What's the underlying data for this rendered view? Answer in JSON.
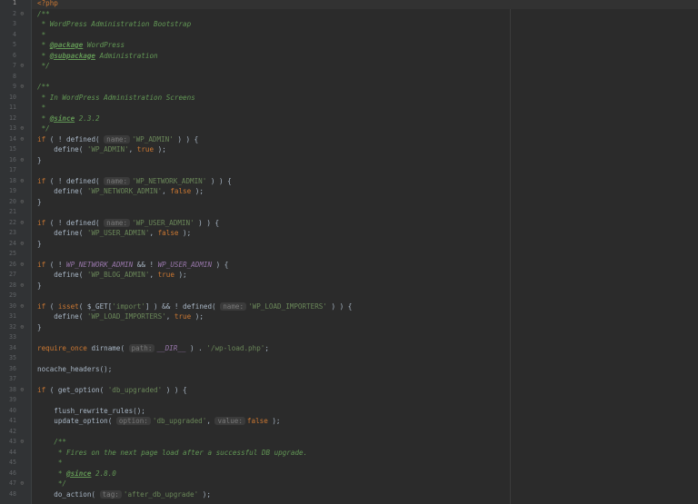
{
  "editor": {
    "current_line": 1,
    "lines": [
      {
        "n": "1",
        "fold": "",
        "segs": [
          {
            "c": "tag",
            "t": "<?php"
          }
        ]
      },
      {
        "n": "2",
        "fold": "⊖",
        "segs": [
          {
            "c": "cm",
            "t": "/**"
          }
        ]
      },
      {
        "n": "3",
        "fold": "",
        "segs": [
          {
            "c": "cm",
            "t": " * WordPress Administration Bootstrap"
          }
        ]
      },
      {
        "n": "4",
        "fold": "",
        "segs": [
          {
            "c": "cm",
            "t": " *"
          }
        ]
      },
      {
        "n": "5",
        "fold": "",
        "segs": [
          {
            "c": "cm",
            "t": " * "
          },
          {
            "c": "cm-tag",
            "t": "@package"
          },
          {
            "c": "cm",
            "t": " WordPress"
          }
        ]
      },
      {
        "n": "6",
        "fold": "",
        "segs": [
          {
            "c": "cm",
            "t": " * "
          },
          {
            "c": "cm-tag",
            "t": "@subpackage"
          },
          {
            "c": "cm",
            "t": " Administration"
          }
        ]
      },
      {
        "n": "7",
        "fold": "⊖",
        "segs": [
          {
            "c": "cm",
            "t": " */"
          }
        ]
      },
      {
        "n": "8",
        "fold": "",
        "segs": []
      },
      {
        "n": "9",
        "fold": "⊖",
        "segs": [
          {
            "c": "cm",
            "t": "/**"
          }
        ]
      },
      {
        "n": "10",
        "fold": "",
        "segs": [
          {
            "c": "cm",
            "t": " * In WordPress Administration Screens"
          }
        ]
      },
      {
        "n": "11",
        "fold": "",
        "segs": [
          {
            "c": "cm",
            "t": " *"
          }
        ]
      },
      {
        "n": "12",
        "fold": "",
        "segs": [
          {
            "c": "cm",
            "t": " * "
          },
          {
            "c": "cm-tag",
            "t": "@since"
          },
          {
            "c": "cm",
            "t": " 2.3.2"
          }
        ]
      },
      {
        "n": "13",
        "fold": "⊖",
        "segs": [
          {
            "c": "cm",
            "t": " */"
          }
        ]
      },
      {
        "n": "14",
        "fold": "⊖",
        "segs": [
          {
            "c": "kw",
            "t": "if"
          },
          {
            "c": "var",
            "t": " ( ! defined( "
          },
          {
            "c": "hint",
            "t": "name:"
          },
          {
            "c": "str",
            "t": "'WP_ADMIN'"
          },
          {
            "c": "var",
            "t": " ) ) {"
          }
        ]
      },
      {
        "n": "15",
        "fold": "",
        "segs": [
          {
            "c": "var",
            "t": "    define( "
          },
          {
            "c": "str",
            "t": "'WP_ADMIN'"
          },
          {
            "c": "var",
            "t": ", "
          },
          {
            "c": "kw",
            "t": "true"
          },
          {
            "c": "var",
            "t": " );"
          }
        ]
      },
      {
        "n": "16",
        "fold": "⊖",
        "segs": [
          {
            "c": "var",
            "t": "}"
          }
        ]
      },
      {
        "n": "17",
        "fold": "",
        "segs": []
      },
      {
        "n": "18",
        "fold": "⊖",
        "segs": [
          {
            "c": "kw",
            "t": "if"
          },
          {
            "c": "var",
            "t": " ( ! defined( "
          },
          {
            "c": "hint",
            "t": "name:"
          },
          {
            "c": "str",
            "t": "'WP_NETWORK_ADMIN'"
          },
          {
            "c": "var",
            "t": " ) ) {"
          }
        ]
      },
      {
        "n": "19",
        "fold": "",
        "segs": [
          {
            "c": "var",
            "t": "    define( "
          },
          {
            "c": "str",
            "t": "'WP_NETWORK_ADMIN'"
          },
          {
            "c": "var",
            "t": ", "
          },
          {
            "c": "kw",
            "t": "false"
          },
          {
            "c": "var",
            "t": " );"
          }
        ]
      },
      {
        "n": "20",
        "fold": "⊖",
        "segs": [
          {
            "c": "var",
            "t": "}"
          }
        ]
      },
      {
        "n": "21",
        "fold": "",
        "segs": []
      },
      {
        "n": "22",
        "fold": "⊖",
        "segs": [
          {
            "c": "kw",
            "t": "if"
          },
          {
            "c": "var",
            "t": " ( ! defined( "
          },
          {
            "c": "hint",
            "t": "name:"
          },
          {
            "c": "str",
            "t": "'WP_USER_ADMIN'"
          },
          {
            "c": "var",
            "t": " ) ) {"
          }
        ]
      },
      {
        "n": "23",
        "fold": "",
        "segs": [
          {
            "c": "var",
            "t": "    define( "
          },
          {
            "c": "str",
            "t": "'WP_USER_ADMIN'"
          },
          {
            "c": "var",
            "t": ", "
          },
          {
            "c": "kw",
            "t": "false"
          },
          {
            "c": "var",
            "t": " );"
          }
        ]
      },
      {
        "n": "24",
        "fold": "⊖",
        "segs": [
          {
            "c": "var",
            "t": "}"
          }
        ]
      },
      {
        "n": "25",
        "fold": "",
        "segs": []
      },
      {
        "n": "26",
        "fold": "⊖",
        "segs": [
          {
            "c": "kw",
            "t": "if"
          },
          {
            "c": "var",
            "t": " ( ! "
          },
          {
            "c": "cst",
            "t": "WP_NETWORK_ADMIN"
          },
          {
            "c": "var",
            "t": " && ! "
          },
          {
            "c": "cst",
            "t": "WP_USER_ADMIN"
          },
          {
            "c": "var",
            "t": " ) {"
          }
        ]
      },
      {
        "n": "27",
        "fold": "",
        "segs": [
          {
            "c": "var",
            "t": "    define( "
          },
          {
            "c": "str",
            "t": "'WP_BLOG_ADMIN'"
          },
          {
            "c": "var",
            "t": ", "
          },
          {
            "c": "kw",
            "t": "true"
          },
          {
            "c": "var",
            "t": " );"
          }
        ]
      },
      {
        "n": "28",
        "fold": "⊖",
        "segs": [
          {
            "c": "var",
            "t": "}"
          }
        ]
      },
      {
        "n": "29",
        "fold": "",
        "segs": []
      },
      {
        "n": "30",
        "fold": "⊖",
        "segs": [
          {
            "c": "kw",
            "t": "if"
          },
          {
            "c": "var",
            "t": " ( "
          },
          {
            "c": "kw",
            "t": "isset"
          },
          {
            "c": "var",
            "t": "( $_GET["
          },
          {
            "c": "str",
            "t": "'import'"
          },
          {
            "c": "var",
            "t": "] ) && ! defined( "
          },
          {
            "c": "hint",
            "t": "name:"
          },
          {
            "c": "str",
            "t": "'WP_LOAD_IMPORTERS'"
          },
          {
            "c": "var",
            "t": " ) ) {"
          }
        ]
      },
      {
        "n": "31",
        "fold": "",
        "segs": [
          {
            "c": "var",
            "t": "    define( "
          },
          {
            "c": "str",
            "t": "'WP_LOAD_IMPORTERS'"
          },
          {
            "c": "var",
            "t": ", "
          },
          {
            "c": "kw",
            "t": "true"
          },
          {
            "c": "var",
            "t": " );"
          }
        ]
      },
      {
        "n": "32",
        "fold": "⊖",
        "segs": [
          {
            "c": "var",
            "t": "}"
          }
        ]
      },
      {
        "n": "33",
        "fold": "",
        "segs": []
      },
      {
        "n": "34",
        "fold": "",
        "segs": [
          {
            "c": "kw",
            "t": "require_once"
          },
          {
            "c": "var",
            "t": " dirname( "
          },
          {
            "c": "hint",
            "t": "path:"
          },
          {
            "c": "cst",
            "t": "__DIR__"
          },
          {
            "c": "var",
            "t": " ) . "
          },
          {
            "c": "str",
            "t": "'/wp-load.php'"
          },
          {
            "c": "var",
            "t": ";"
          }
        ]
      },
      {
        "n": "35",
        "fold": "",
        "segs": []
      },
      {
        "n": "36",
        "fold": "",
        "segs": [
          {
            "c": "var",
            "t": "nocache_headers();"
          }
        ]
      },
      {
        "n": "37",
        "fold": "",
        "segs": []
      },
      {
        "n": "38",
        "fold": "⊖",
        "segs": [
          {
            "c": "kw",
            "t": "if"
          },
          {
            "c": "var",
            "t": " ( get_option( "
          },
          {
            "c": "str",
            "t": "'db_upgraded'"
          },
          {
            "c": "var",
            "t": " ) ) {"
          }
        ]
      },
      {
        "n": "39",
        "fold": "",
        "segs": []
      },
      {
        "n": "40",
        "fold": "",
        "segs": [
          {
            "c": "var",
            "t": "    flush_rewrite_rules();"
          }
        ]
      },
      {
        "n": "41",
        "fold": "",
        "segs": [
          {
            "c": "var",
            "t": "    update_option( "
          },
          {
            "c": "hint",
            "t": "option:"
          },
          {
            "c": "str",
            "t": "'db_upgraded'"
          },
          {
            "c": "var",
            "t": ", "
          },
          {
            "c": "hint",
            "t": "value:"
          },
          {
            "c": "kw",
            "t": "false"
          },
          {
            "c": "var",
            "t": " );"
          }
        ]
      },
      {
        "n": "42",
        "fold": "",
        "segs": []
      },
      {
        "n": "43",
        "fold": "⊖",
        "segs": [
          {
            "c": "cm",
            "t": "    /**"
          }
        ]
      },
      {
        "n": "44",
        "fold": "",
        "segs": [
          {
            "c": "cm",
            "t": "     * Fires on the next page load after a successful DB upgrade."
          }
        ]
      },
      {
        "n": "45",
        "fold": "",
        "segs": [
          {
            "c": "cm",
            "t": "     *"
          }
        ]
      },
      {
        "n": "46",
        "fold": "",
        "segs": [
          {
            "c": "cm",
            "t": "     * "
          },
          {
            "c": "cm-tag",
            "t": "@since"
          },
          {
            "c": "cm",
            "t": " 2.8.0"
          }
        ]
      },
      {
        "n": "47",
        "fold": "⊖",
        "segs": [
          {
            "c": "cm",
            "t": "     */"
          }
        ]
      },
      {
        "n": "48",
        "fold": "",
        "segs": [
          {
            "c": "var",
            "t": "    do_action( "
          },
          {
            "c": "hint",
            "t": "tag:"
          },
          {
            "c": "str",
            "t": "'after_db_upgrade'"
          },
          {
            "c": "var",
            "t": " );"
          }
        ]
      }
    ]
  }
}
